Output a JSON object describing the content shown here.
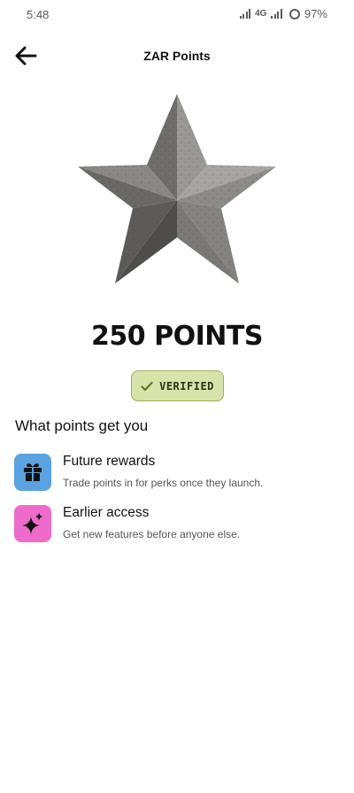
{
  "status_bar": {
    "time": "5:48",
    "network": "4G",
    "battery": "97%"
  },
  "header": {
    "title": "ZAR Points",
    "back_icon": "arrow-left-icon"
  },
  "hero": {
    "icon": "concrete-star-icon",
    "points_title": "250 POINTS",
    "badge_label": "VERIFIED",
    "badge_icon": "checkmark-icon"
  },
  "benefits": {
    "section_title": "What points get you",
    "items": [
      {
        "title": "Future rewards",
        "description": "Trade points in for perks once they launch.",
        "icon": "gift-icon",
        "color": "#5aa2e0"
      },
      {
        "title": "Earlier access",
        "description": "Get new features before anyone else.",
        "icon": "sparkles-icon",
        "color": "#ee6bcc"
      }
    ]
  },
  "colors": {
    "badge_fill": "#d7e3ab",
    "badge_border": "#9aae58",
    "text_primary": "#111111"
  }
}
